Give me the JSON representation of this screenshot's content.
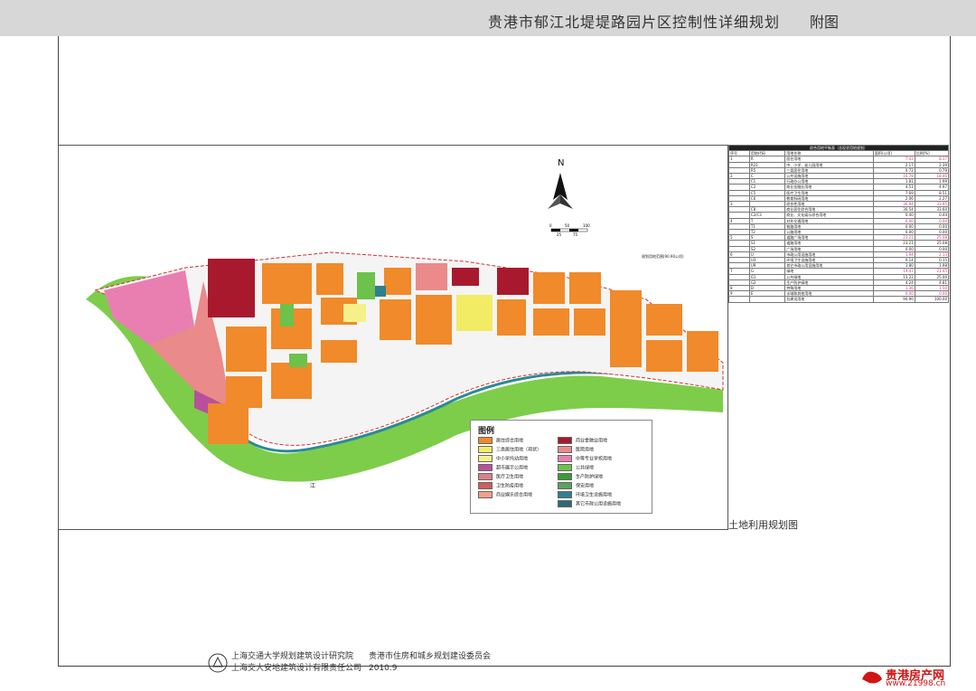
{
  "header": {
    "title": "贵港市郁江北堤堤路园片区控制性详细规划",
    "figure": "附图"
  },
  "map": {
    "north_label": "N",
    "scale": {
      "ticks_top": [
        "0",
        "50",
        "100"
      ],
      "ticks_bottom": [
        "25",
        "75"
      ]
    },
    "boundary_label": "规划用地范围(90.90公顷)",
    "river_label": "江",
    "legend_title": "图例",
    "caption": "土地利用规划图",
    "colors": {
      "residential": "#f08a2a",
      "commercial_finance": "#a8192e",
      "resettle": "#f2ec64",
      "hospital": "#ea8a8a",
      "school": "#f5f08a",
      "middle_school": "#e97fb0",
      "market": "#b8509c",
      "greenspace": "#6cc24a",
      "medical": "#d9818c",
      "protect_green": "#3a9a3a",
      "health": "#c9605c",
      "security": "#59a359",
      "entertainment": "#f1a08a",
      "sanitation": "#2f7f8f",
      "utility": "#2c6a78",
      "river_green": "#7dcd4a",
      "road": "#f4f4f4"
    }
  },
  "legend": [
    {
      "label": "居住综合用地",
      "color": "#f08a2a"
    },
    {
      "label": "商业金融业用地",
      "color": "#a8192e"
    },
    {
      "label": "三类居住用地（现状）",
      "color": "#f2ec64"
    },
    {
      "label": "医院用地",
      "color": "#ea8a8a"
    },
    {
      "label": "中小学托幼用地",
      "color": "#f5f08a"
    },
    {
      "label": "中等专业学校用地",
      "color": "#e97fb0"
    },
    {
      "label": "超市展示公用地",
      "color": "#b8509c"
    },
    {
      "label": "公共绿地",
      "color": "#6cc24a"
    },
    {
      "label": "医疗卫生用地",
      "color": "#d9818c"
    },
    {
      "label": "生产防护绿地",
      "color": "#3a9a3a"
    },
    {
      "label": "卫生防疫用地",
      "color": "#c9605c"
    },
    {
      "label": "保安用地",
      "color": "#59a359"
    },
    {
      "label": "商业娱乐综合用地",
      "color": "#f1a08a"
    },
    {
      "label": "环境卫生设施用地",
      "color": "#2f7f8f"
    },
    {
      "label": "",
      "color": ""
    },
    {
      "label": "其它市政公用设施用地",
      "color": "#2c6a78"
    }
  ],
  "land_table": {
    "caption": "综合用地平衡表（含现状用地规划）",
    "headers": [
      "序号",
      "用地代码",
      "用地名称",
      "面积(公顷)",
      "比例(%)"
    ],
    "rows": [
      [
        "1",
        "R",
        "居住用地",
        "7.43",
        "8.17"
      ],
      [
        "",
        "R22",
        "中、小学、幼儿园用地",
        "2.17",
        "2.39"
      ],
      [
        "",
        "R5",
        "三类居住用地",
        "0.72",
        "0.79"
      ],
      [
        "2",
        "C",
        "公共设施用地",
        "16.78",
        "18.46"
      ],
      [
        "",
        "C1",
        "行政办公用地",
        "1.81",
        "1.99"
      ],
      [
        "",
        "C2",
        "商业金融业用地",
        "4.51",
        "4.97"
      ],
      [
        "",
        "C5",
        "医疗卫生用地",
        "7.69",
        "8.51"
      ],
      [
        "",
        "C6",
        "教育科研用地",
        "2.06",
        "2.27"
      ],
      [
        "3",
        "",
        "综合性用地",
        "30.94",
        "33.95"
      ],
      [
        "",
        "C8",
        "商业居住综合用地",
        "30.54",
        "33.60"
      ],
      [
        "",
        "C2/C3",
        "商业、文化娱乐综合用地",
        "0.40",
        "0.44"
      ],
      [
        "4",
        "T",
        "对外交通用地",
        "0.00",
        "0.00"
      ],
      [
        "",
        "T1",
        "铁路用地",
        "0.00",
        "0.00"
      ],
      [
        "",
        "T2",
        "公路用地",
        "0.00",
        "0.00"
      ],
      [
        "5",
        "S",
        "道路广场用地",
        "23.21",
        "25.08"
      ],
      [
        "",
        "S1",
        "道路用地",
        "23.21",
        "25.08"
      ],
      [
        "",
        "S2",
        "广场用地",
        "0.00",
        "0.00"
      ],
      [
        "6",
        "U",
        "市政公用设施用地",
        "1.94",
        "2.13"
      ],
      [
        "",
        "U3",
        "环境卫生设施用地",
        "0.14",
        "0.15"
      ],
      [
        "",
        "U9",
        "其它市政公用设施用地",
        "1.80",
        "1.98"
      ],
      [
        "7",
        "G",
        "绿地",
        "19.47",
        "21.45"
      ],
      [
        "",
        "G1",
        "公共绿地",
        "13.22",
        "25.00"
      ],
      [
        "",
        "G2",
        "生产防护绿地",
        "4.24",
        "4.81"
      ],
      [
        "8",
        "D",
        "特殊用地",
        "1.36",
        "1.50"
      ],
      [
        "9",
        "E",
        "水域和其他用地",
        "0.00",
        "0.00"
      ],
      [
        "",
        "",
        "总建设用地",
        "90.90",
        "100.00"
      ]
    ]
  },
  "footer": {
    "org1": "上海交通大学规划建筑设计研究院",
    "org2": "上海交大安地建筑设计有限责任公司",
    "client": "贵港市住房和城乡规划建设委员会",
    "date": "2010.9"
  },
  "watermark": {
    "name": "贵港房产网",
    "url": "www.21998.cn"
  }
}
